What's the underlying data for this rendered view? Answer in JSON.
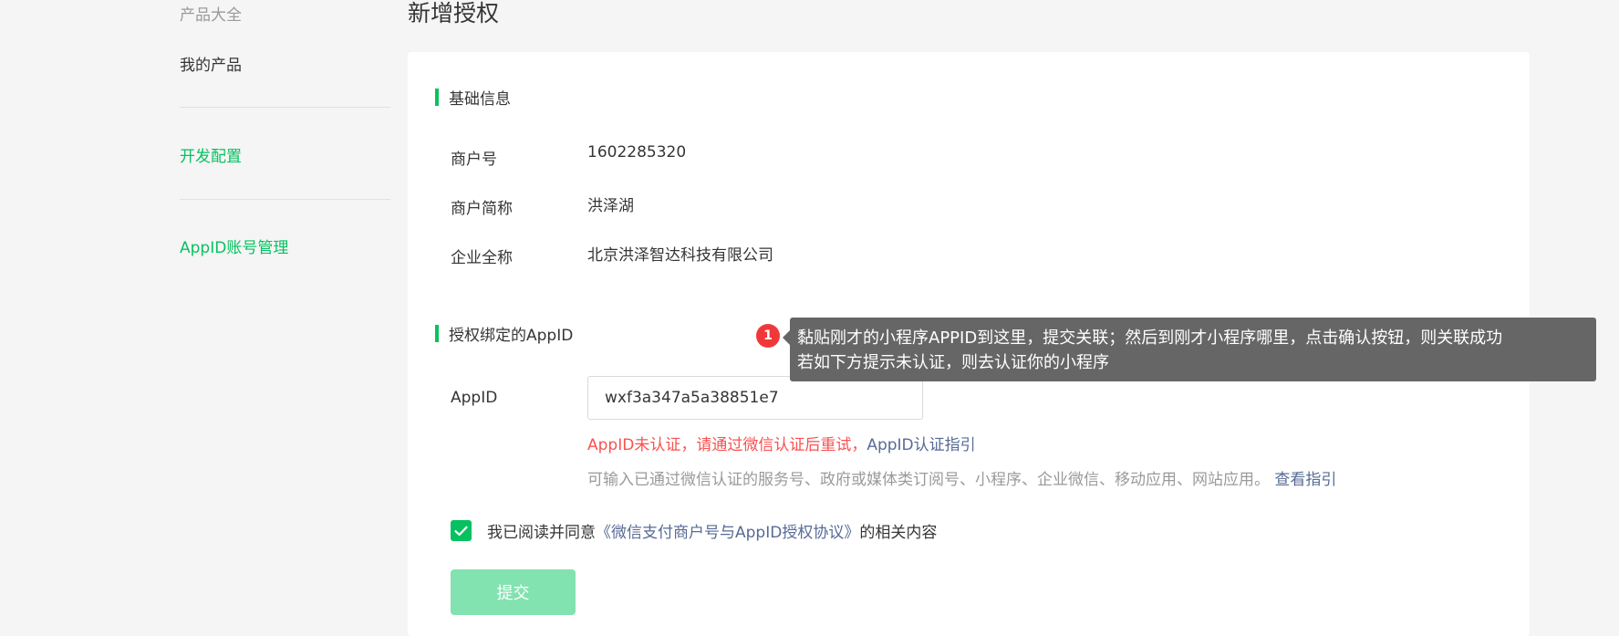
{
  "sidebar": {
    "items": [
      {
        "label": "产品大全"
      },
      {
        "label": "我的产品"
      },
      {
        "label": "开发配置"
      },
      {
        "label": "AppID账号管理"
      }
    ]
  },
  "page": {
    "title": "新增授权"
  },
  "basic_info": {
    "section_title": "基础信息",
    "rows": [
      {
        "label": "商户号",
        "value": "1602285320"
      },
      {
        "label": "商户简称",
        "value": "洪泽湖"
      },
      {
        "label": "企业全称",
        "value": "北京洪泽智达科技有限公司"
      }
    ]
  },
  "appid_section": {
    "section_title": "授权绑定的AppID",
    "label": "AppID",
    "input_value": "wxf3a347a5a38851e7",
    "error_text": "AppID未认证，请通过微信认证后重试，",
    "error_link": "AppID认证指引",
    "hint_text": "可输入已通过微信认证的服务号、政府或媒体类订阅号、小程序、企业微信、移动应用、网站应用。",
    "hint_link": "查看指引"
  },
  "agreement": {
    "checked": true,
    "prefix": "我已阅读并同意",
    "link": "《微信支付商户号与AppID授权协议》",
    "suffix": "的相关内容"
  },
  "submit": {
    "label": "提交"
  },
  "annotation": {
    "badge": "1",
    "line1": "黏贴刚才的小程序APPID到这里，提交关联；然后到刚才小程序哪里，点击确认按钮，则关联成功",
    "line2": "若如下方提示未认证，则去认证你的小程序"
  },
  "colors": {
    "accent": "#07c160",
    "error": "#fa5151",
    "link": "#576b95",
    "submit_disabled": "#82e2b0",
    "tooltip_bg": "#666666",
    "badge": "#f0383a"
  }
}
